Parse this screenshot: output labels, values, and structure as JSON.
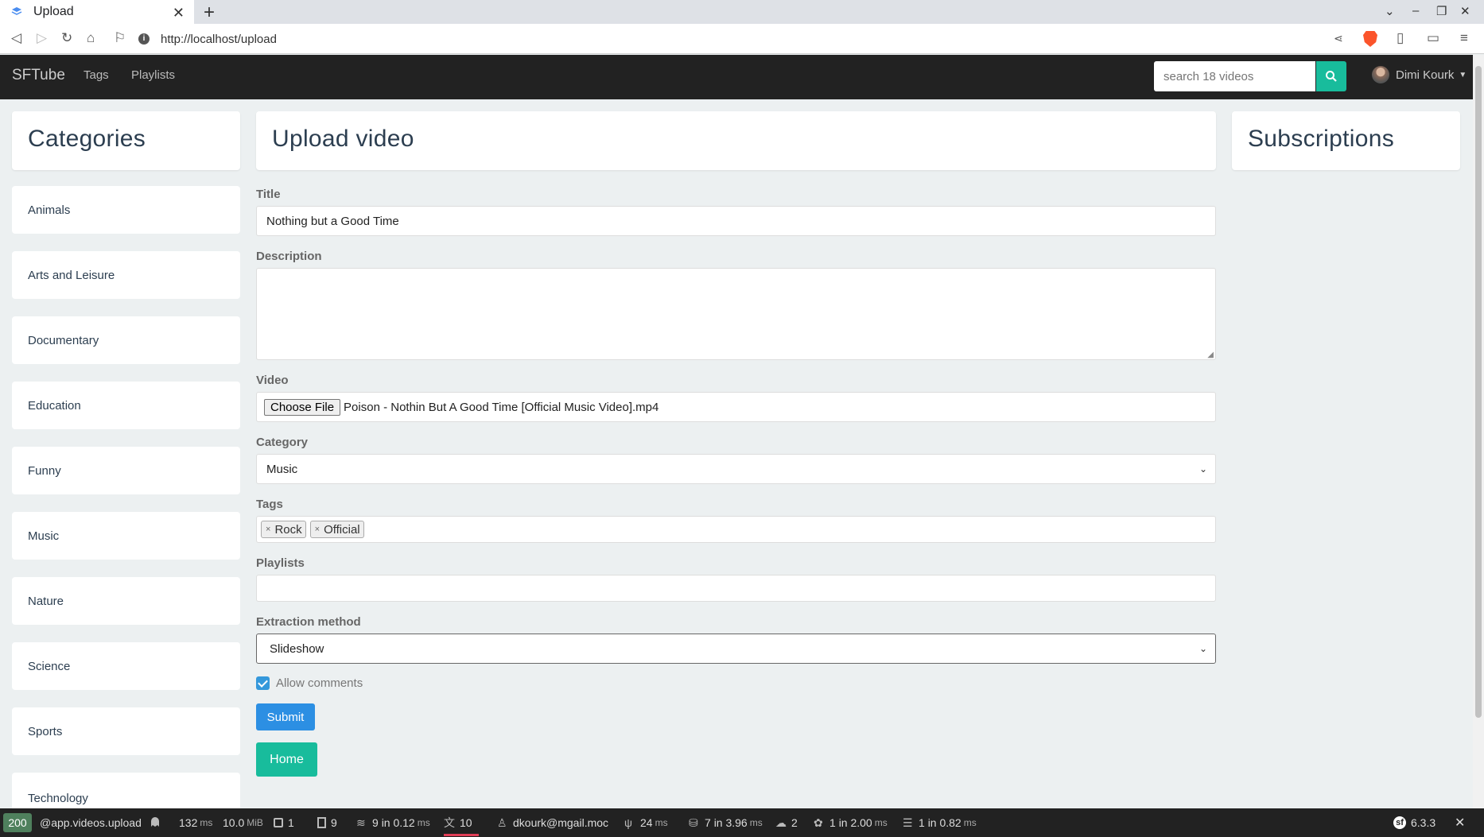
{
  "browser": {
    "tab_title": "Upload",
    "url": "http://localhost/upload"
  },
  "navbar": {
    "brand": "SFTube",
    "links": [
      "Tags",
      "Playlists"
    ],
    "search_placeholder": "search 18 videos",
    "user_name": "Dimi Kourk"
  },
  "categories": {
    "heading": "Categories",
    "items": [
      "Animals",
      "Arts and Leisure",
      "Documentary",
      "Education",
      "Funny",
      "Music",
      "Nature",
      "Science",
      "Sports",
      "Technology"
    ]
  },
  "main": {
    "heading": "Upload video"
  },
  "subscriptions": {
    "heading": "Subscriptions"
  },
  "form": {
    "title_label": "Title",
    "title_value": "Nothing but a Good Time",
    "description_label": "Description",
    "description_value": "",
    "video_label": "Video",
    "choose_file_label": "Choose File",
    "video_filename": "Poison - Nothin But A Good Time [Official Music Video].mp4",
    "category_label": "Category",
    "category_value": "Music",
    "tags_label": "Tags",
    "tags": [
      "Rock",
      "Official"
    ],
    "tag_remove_symbol": "×",
    "playlists_label": "Playlists",
    "extraction_label": "Extraction method",
    "extraction_value": "Slideshow",
    "allow_comments_label": "Allow comments",
    "allow_comments_checked": true,
    "submit_label": "Submit",
    "home_label": "Home"
  },
  "colors": {
    "navbar_bg": "#222222",
    "success": "#18bc9c",
    "primary": "#3498db",
    "page_bg": "#ecf0f1"
  },
  "symfony_toolbar": {
    "status_code": "200",
    "route": "@app.videos.upload",
    "time": "132",
    "time_unit": "ms",
    "memory": "10.0",
    "memory_unit": "MiB",
    "forms": "1",
    "validation": "9",
    "cache_calls": "9",
    "cache_time": "in 0.12",
    "cache_unit": "ms",
    "translations": "10",
    "user_email": "dkourk@mgail.moc",
    "twig_time": "24",
    "twig_unit": "ms",
    "db_queries": "7",
    "db_time": "in 3.96",
    "db_unit": "ms",
    "http_calls": "2",
    "events": "1",
    "events_time": "in 2.00",
    "events_unit": "ms",
    "layers": "1",
    "layers_time": "in 0.82",
    "layers_unit": "ms",
    "symfony_version": "6.3.3"
  }
}
